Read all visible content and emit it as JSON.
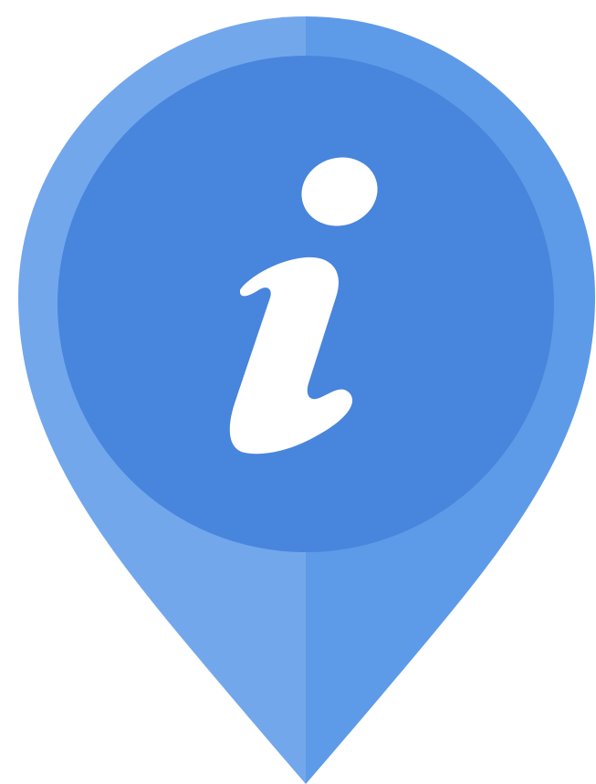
{
  "icon": {
    "name": "info-location-pin-icon",
    "glyph": "info-i",
    "colors": {
      "pin_left_half": "#73a7ec",
      "pin_right_half": "#5d9be8",
      "inner_disc": "#4885dc",
      "glyph": "#ffffff",
      "background": "#ffffff"
    }
  }
}
